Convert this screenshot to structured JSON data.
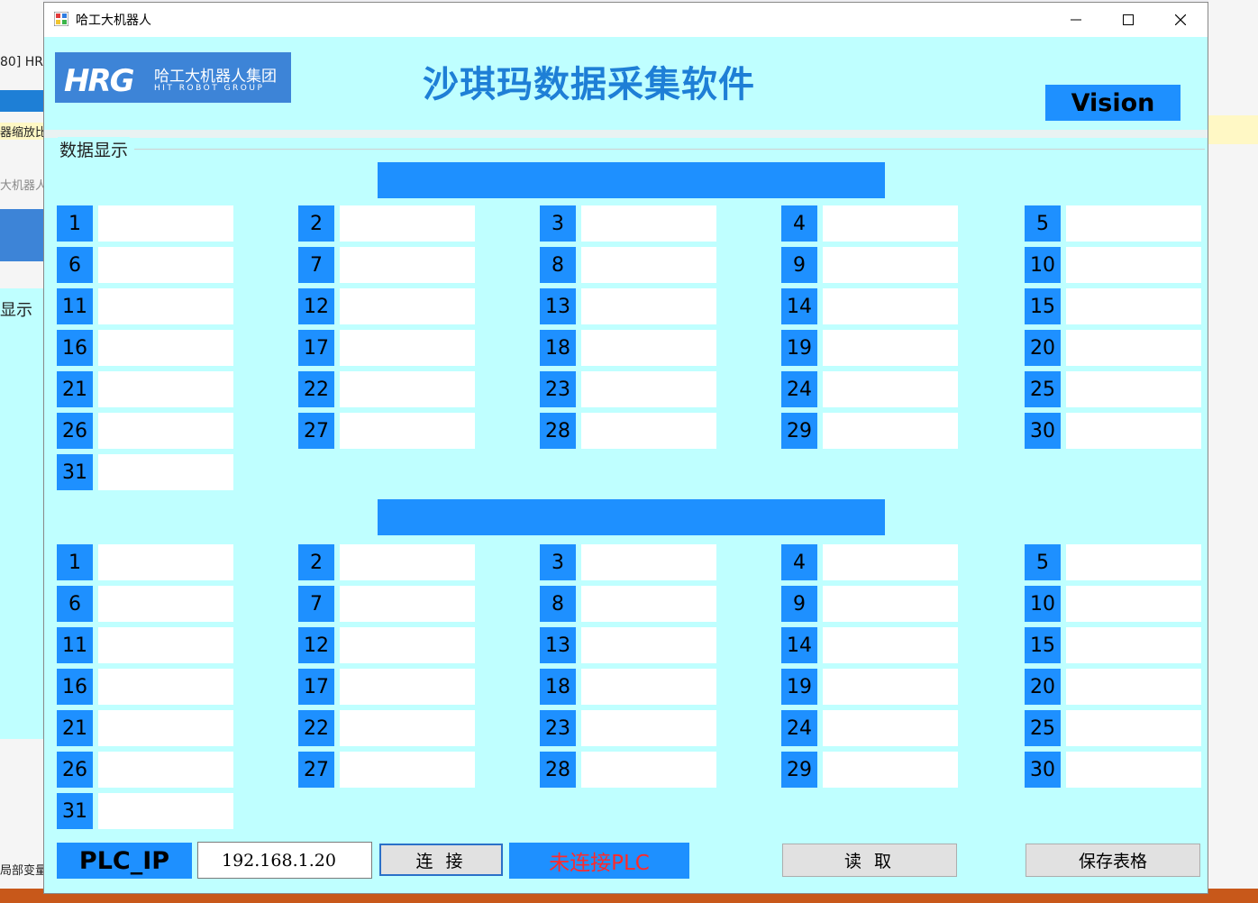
{
  "window": {
    "title": "哈工大机器人",
    "minimize_glyph": "—",
    "maximize_glyph": "☐",
    "close_glyph": "✕"
  },
  "logo": {
    "mark": "HRG",
    "name_cn": "哈工大机器人集团",
    "name_en": "HIT ROBOT GROUP"
  },
  "header": {
    "app_title": "沙琪玛数据采集软件",
    "vision_button": "Vision"
  },
  "group": {
    "label": "数据显示"
  },
  "section1": {
    "cells": [
      {
        "num": "1",
        "value": ""
      },
      {
        "num": "2",
        "value": ""
      },
      {
        "num": "3",
        "value": ""
      },
      {
        "num": "4",
        "value": ""
      },
      {
        "num": "5",
        "value": ""
      },
      {
        "num": "6",
        "value": ""
      },
      {
        "num": "7",
        "value": ""
      },
      {
        "num": "8",
        "value": ""
      },
      {
        "num": "9",
        "value": ""
      },
      {
        "num": "10",
        "value": ""
      },
      {
        "num": "11",
        "value": ""
      },
      {
        "num": "12",
        "value": ""
      },
      {
        "num": "13",
        "value": ""
      },
      {
        "num": "14",
        "value": ""
      },
      {
        "num": "15",
        "value": ""
      },
      {
        "num": "16",
        "value": ""
      },
      {
        "num": "17",
        "value": ""
      },
      {
        "num": "18",
        "value": ""
      },
      {
        "num": "19",
        "value": ""
      },
      {
        "num": "20",
        "value": ""
      },
      {
        "num": "21",
        "value": ""
      },
      {
        "num": "22",
        "value": ""
      },
      {
        "num": "23",
        "value": ""
      },
      {
        "num": "24",
        "value": ""
      },
      {
        "num": "25",
        "value": ""
      },
      {
        "num": "26",
        "value": ""
      },
      {
        "num": "27",
        "value": ""
      },
      {
        "num": "28",
        "value": ""
      },
      {
        "num": "29",
        "value": ""
      },
      {
        "num": "30",
        "value": ""
      },
      {
        "num": "31",
        "value": ""
      }
    ]
  },
  "section2": {
    "cells": [
      {
        "num": "1",
        "value": ""
      },
      {
        "num": "2",
        "value": ""
      },
      {
        "num": "3",
        "value": ""
      },
      {
        "num": "4",
        "value": ""
      },
      {
        "num": "5",
        "value": ""
      },
      {
        "num": "6",
        "value": ""
      },
      {
        "num": "7",
        "value": ""
      },
      {
        "num": "8",
        "value": ""
      },
      {
        "num": "9",
        "value": ""
      },
      {
        "num": "10",
        "value": ""
      },
      {
        "num": "11",
        "value": ""
      },
      {
        "num": "12",
        "value": ""
      },
      {
        "num": "13",
        "value": ""
      },
      {
        "num": "14",
        "value": ""
      },
      {
        "num": "15",
        "value": ""
      },
      {
        "num": "16",
        "value": ""
      },
      {
        "num": "17",
        "value": ""
      },
      {
        "num": "18",
        "value": ""
      },
      {
        "num": "19",
        "value": ""
      },
      {
        "num": "20",
        "value": ""
      },
      {
        "num": "21",
        "value": ""
      },
      {
        "num": "22",
        "value": ""
      },
      {
        "num": "23",
        "value": ""
      },
      {
        "num": "24",
        "value": ""
      },
      {
        "num": "25",
        "value": ""
      },
      {
        "num": "26",
        "value": ""
      },
      {
        "num": "27",
        "value": ""
      },
      {
        "num": "28",
        "value": ""
      },
      {
        "num": "29",
        "value": ""
      },
      {
        "num": "30",
        "value": ""
      },
      {
        "num": "31",
        "value": ""
      }
    ]
  },
  "footer": {
    "plc_label": "PLC_IP",
    "ip_value": "192.168.1.20",
    "connect_button": "连 接",
    "status_text": "未连接PLC",
    "read_button": "读 取",
    "save_button": "保存表格"
  },
  "background_ide": {
    "fragments": [
      "80] HR",
      "器缩放比",
      "大机器人",
      "显示",
      "局部变量"
    ]
  },
  "colors": {
    "window_bg": "#bfffff",
    "accent": "#1e90ff",
    "title_blue": "#1e7fd6",
    "status_red": "#ff2a2a"
  }
}
